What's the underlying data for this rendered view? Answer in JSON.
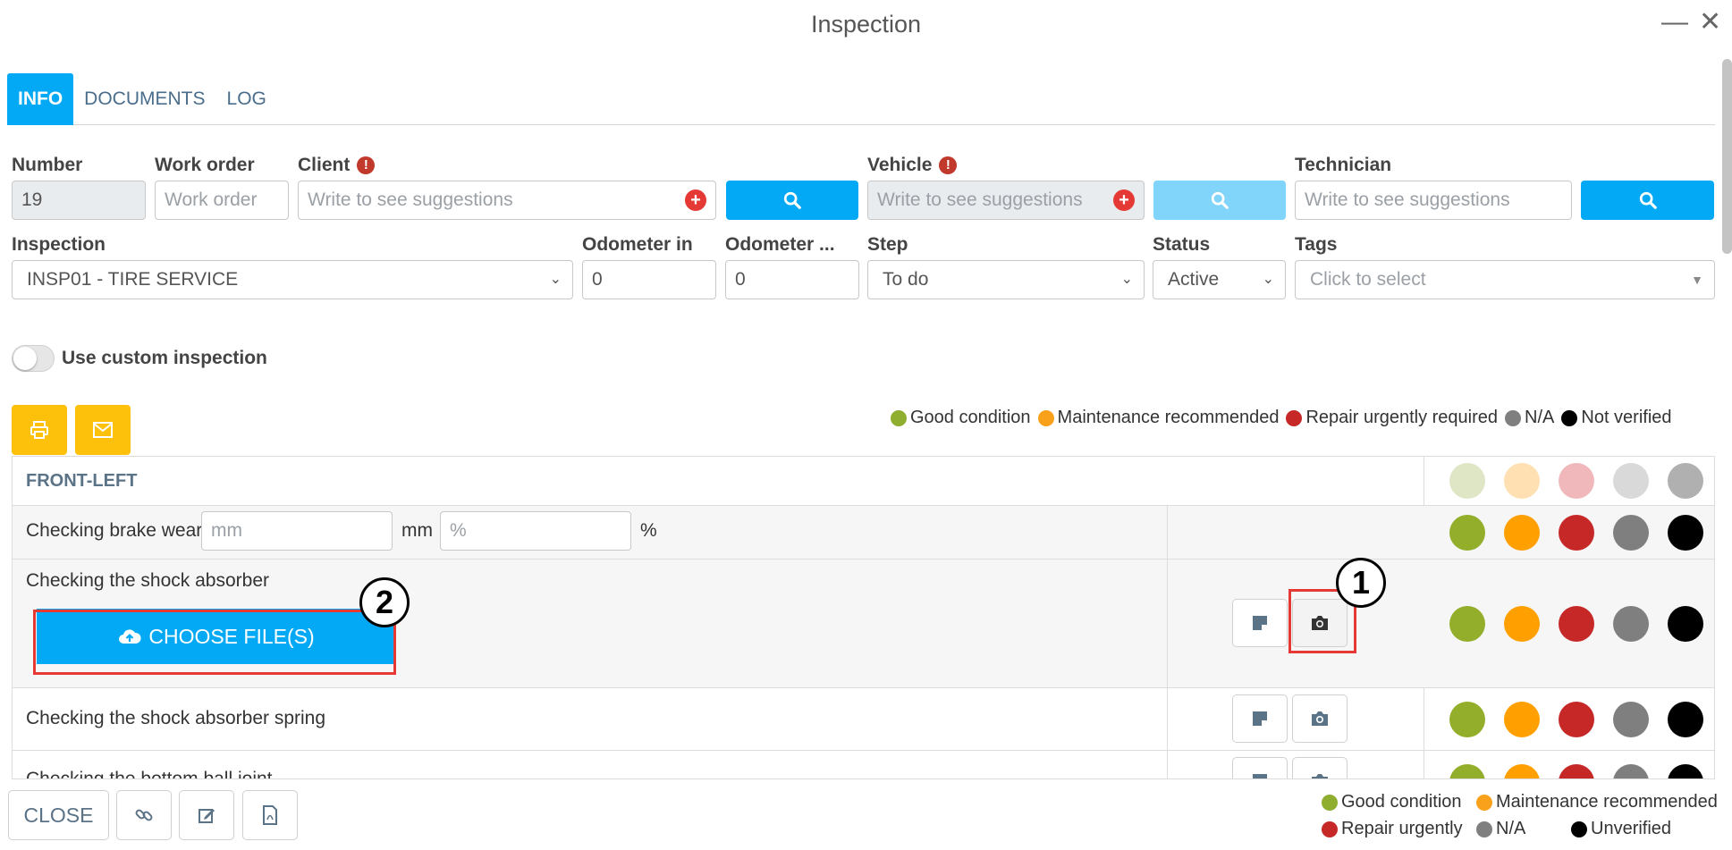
{
  "window": {
    "title": "Inspection"
  },
  "tabs": [
    {
      "label": "INFO",
      "active": true
    },
    {
      "label": "DOCUMENTS",
      "active": false
    },
    {
      "label": "LOG",
      "active": false
    }
  ],
  "form": {
    "number": {
      "label": "Number",
      "value": "19"
    },
    "work_order": {
      "label": "Work order",
      "placeholder": "Work order"
    },
    "client": {
      "label": "Client",
      "placeholder": "Write to see suggestions"
    },
    "vehicle": {
      "label": "Vehicle",
      "placeholder": "Write to see suggestions"
    },
    "technician": {
      "label": "Technician",
      "placeholder": "Write to see suggestions"
    },
    "inspection": {
      "label": "Inspection",
      "value": "INSP01 - TIRE SERVICE"
    },
    "odometer_in": {
      "label": "Odometer in",
      "value": "0"
    },
    "odometer_out": {
      "label": "Odometer ...",
      "value": "0"
    },
    "step": {
      "label": "Step",
      "value": "To do"
    },
    "status": {
      "label": "Status",
      "value": "Active"
    },
    "tags": {
      "label": "Tags",
      "placeholder": "Click to select"
    }
  },
  "custom_inspection": {
    "label": "Use custom inspection",
    "enabled": false
  },
  "legend": [
    {
      "label": "Good condition",
      "color": "#8fae2f"
    },
    {
      "label": "Maintenance recommended",
      "color": "#f9a11b"
    },
    {
      "label": "Repair urgently required",
      "color": "#c62828"
    },
    {
      "label": "N/A",
      "color": "#7f7f7f"
    },
    {
      "label": "Not verified",
      "color": "#000000"
    }
  ],
  "section": {
    "title": "FRONT-LEFT",
    "header_colors": [
      "#dfe6c6",
      "#ffe0b2",
      "#f1b8bb",
      "#d9d9d9",
      "#b0b0b0"
    ],
    "status_colors": [
      "#93ae2b",
      "#ffa000",
      "#c62828",
      "#7f7f7f",
      "#000000"
    ]
  },
  "items": [
    {
      "label": "Checking brake wear",
      "mm_placeholder": "mm",
      "mm_unit": "mm",
      "pct_placeholder": "%",
      "pct_unit": "%"
    },
    {
      "label": "Checking the shock absorber",
      "choose_files": "CHOOSE FILE(S)"
    },
    {
      "label": "Checking the shock absorber spring"
    },
    {
      "label": "Checking the bottom ball joint"
    }
  ],
  "callouts": {
    "one": "1",
    "two": "2"
  },
  "footer": {
    "close_label": "CLOSE",
    "legend": [
      {
        "label": "Good condition",
        "color": "#8fae2f"
      },
      {
        "label": "Maintenance recommended",
        "color": "#f9a11b"
      },
      {
        "label": "Repair urgently",
        "color": "#c62828"
      },
      {
        "label": "N/A",
        "color": "#7f7f7f"
      },
      {
        "label": "Unverified",
        "color": "#000000"
      }
    ]
  }
}
